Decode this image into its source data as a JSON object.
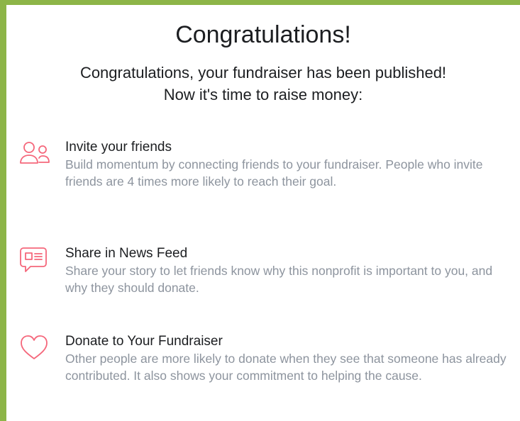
{
  "dialog": {
    "title": "Congratulations!",
    "subtitle_line1": "Congratulations, your fundraiser has been published!",
    "subtitle_line2": "Now it's time to raise money:"
  },
  "items": [
    {
      "icon": "friends-icon",
      "heading": "Invite your friends",
      "description": "Build momentum by connecting friends to your fundraiser. People who invite friends are 4 times more likely to reach their goal."
    },
    {
      "icon": "news-feed-icon",
      "heading": "Share in News Feed",
      "description": "Share your story to let friends know why this nonprofit is important to you, and why they should donate."
    },
    {
      "icon": "heart-icon",
      "heading": "Donate to Your Fundraiser",
      "description": "Other people are more likely to donate when they see that someone has already contributed. It also shows your commitment to helping the cause."
    }
  ],
  "colors": {
    "border": "#8db548",
    "icon_accent": "#f5677b",
    "heading": "#1c1e21",
    "description": "#8d949e"
  }
}
